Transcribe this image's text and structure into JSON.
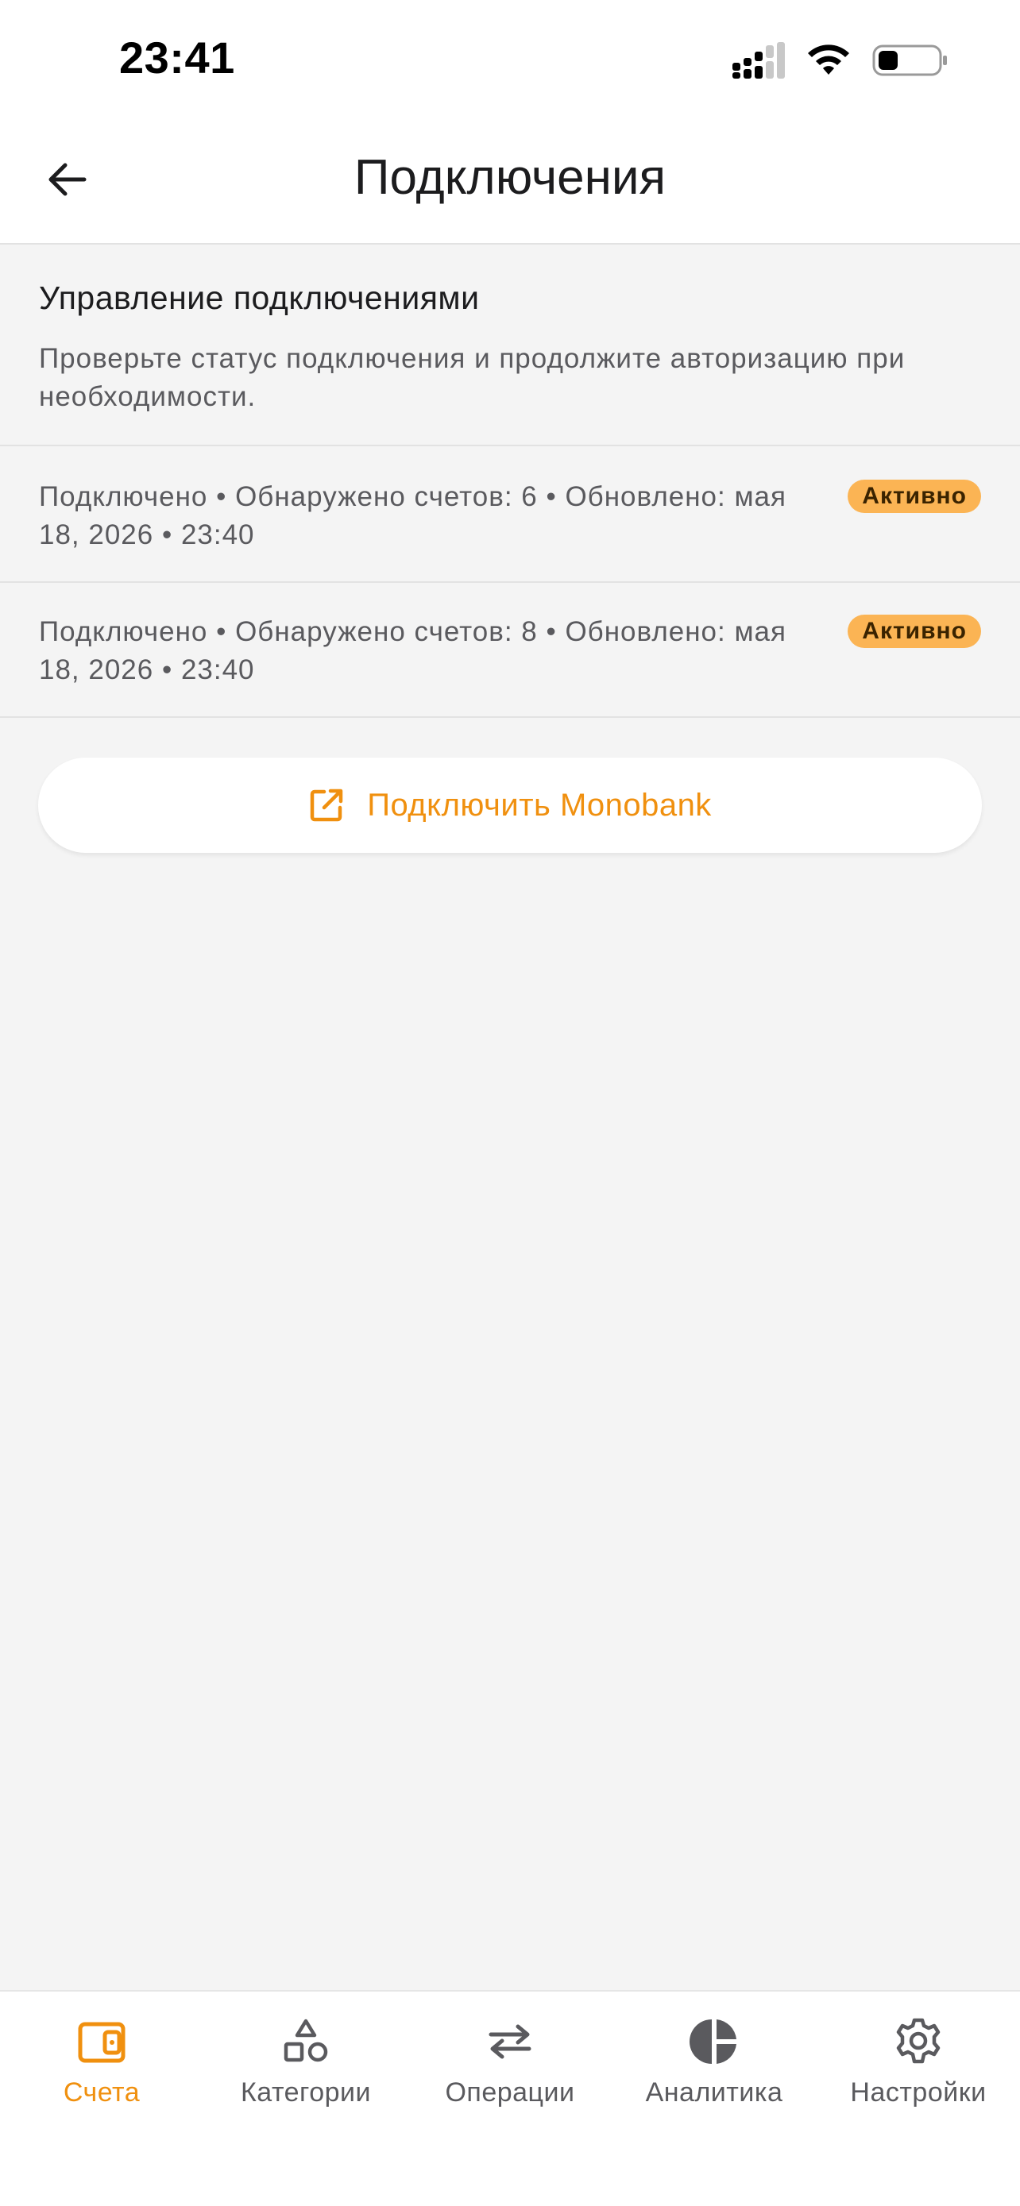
{
  "status_bar": {
    "time": "23:41"
  },
  "header": {
    "title": "Подключения"
  },
  "intro": {
    "title": "Управление подключениями",
    "description": "Проверьте статус подключения и продолжите авторизацию при необходимости."
  },
  "connections": [
    {
      "info": "Подключено • Обнаружено счетов: 6 • Обновлено: мая 18, 2026 • 23:40",
      "status": "Активно"
    },
    {
      "info": "Подключено • Обнаружено счетов: 8 • Обновлено: мая 18, 2026 • 23:40",
      "status": "Активно"
    }
  ],
  "connect_button": {
    "label": "Подключить Monobank",
    "icon": "external-link-icon"
  },
  "bottom_nav": {
    "items": [
      {
        "label": "Счета",
        "icon": "wallet-icon",
        "active": true
      },
      {
        "label": "Категории",
        "icon": "shapes-icon",
        "active": false
      },
      {
        "label": "Операции",
        "icon": "transfer-arrows-icon",
        "active": false
      },
      {
        "label": "Аналитика",
        "icon": "pie-chart-icon",
        "active": false
      },
      {
        "label": "Настройки",
        "icon": "gear-icon",
        "active": false
      }
    ]
  },
  "colors": {
    "accent": "#f0900f",
    "badge_bg": "#fbb454",
    "background": "#f4f4f4",
    "muted_text": "#5a5a5e"
  }
}
